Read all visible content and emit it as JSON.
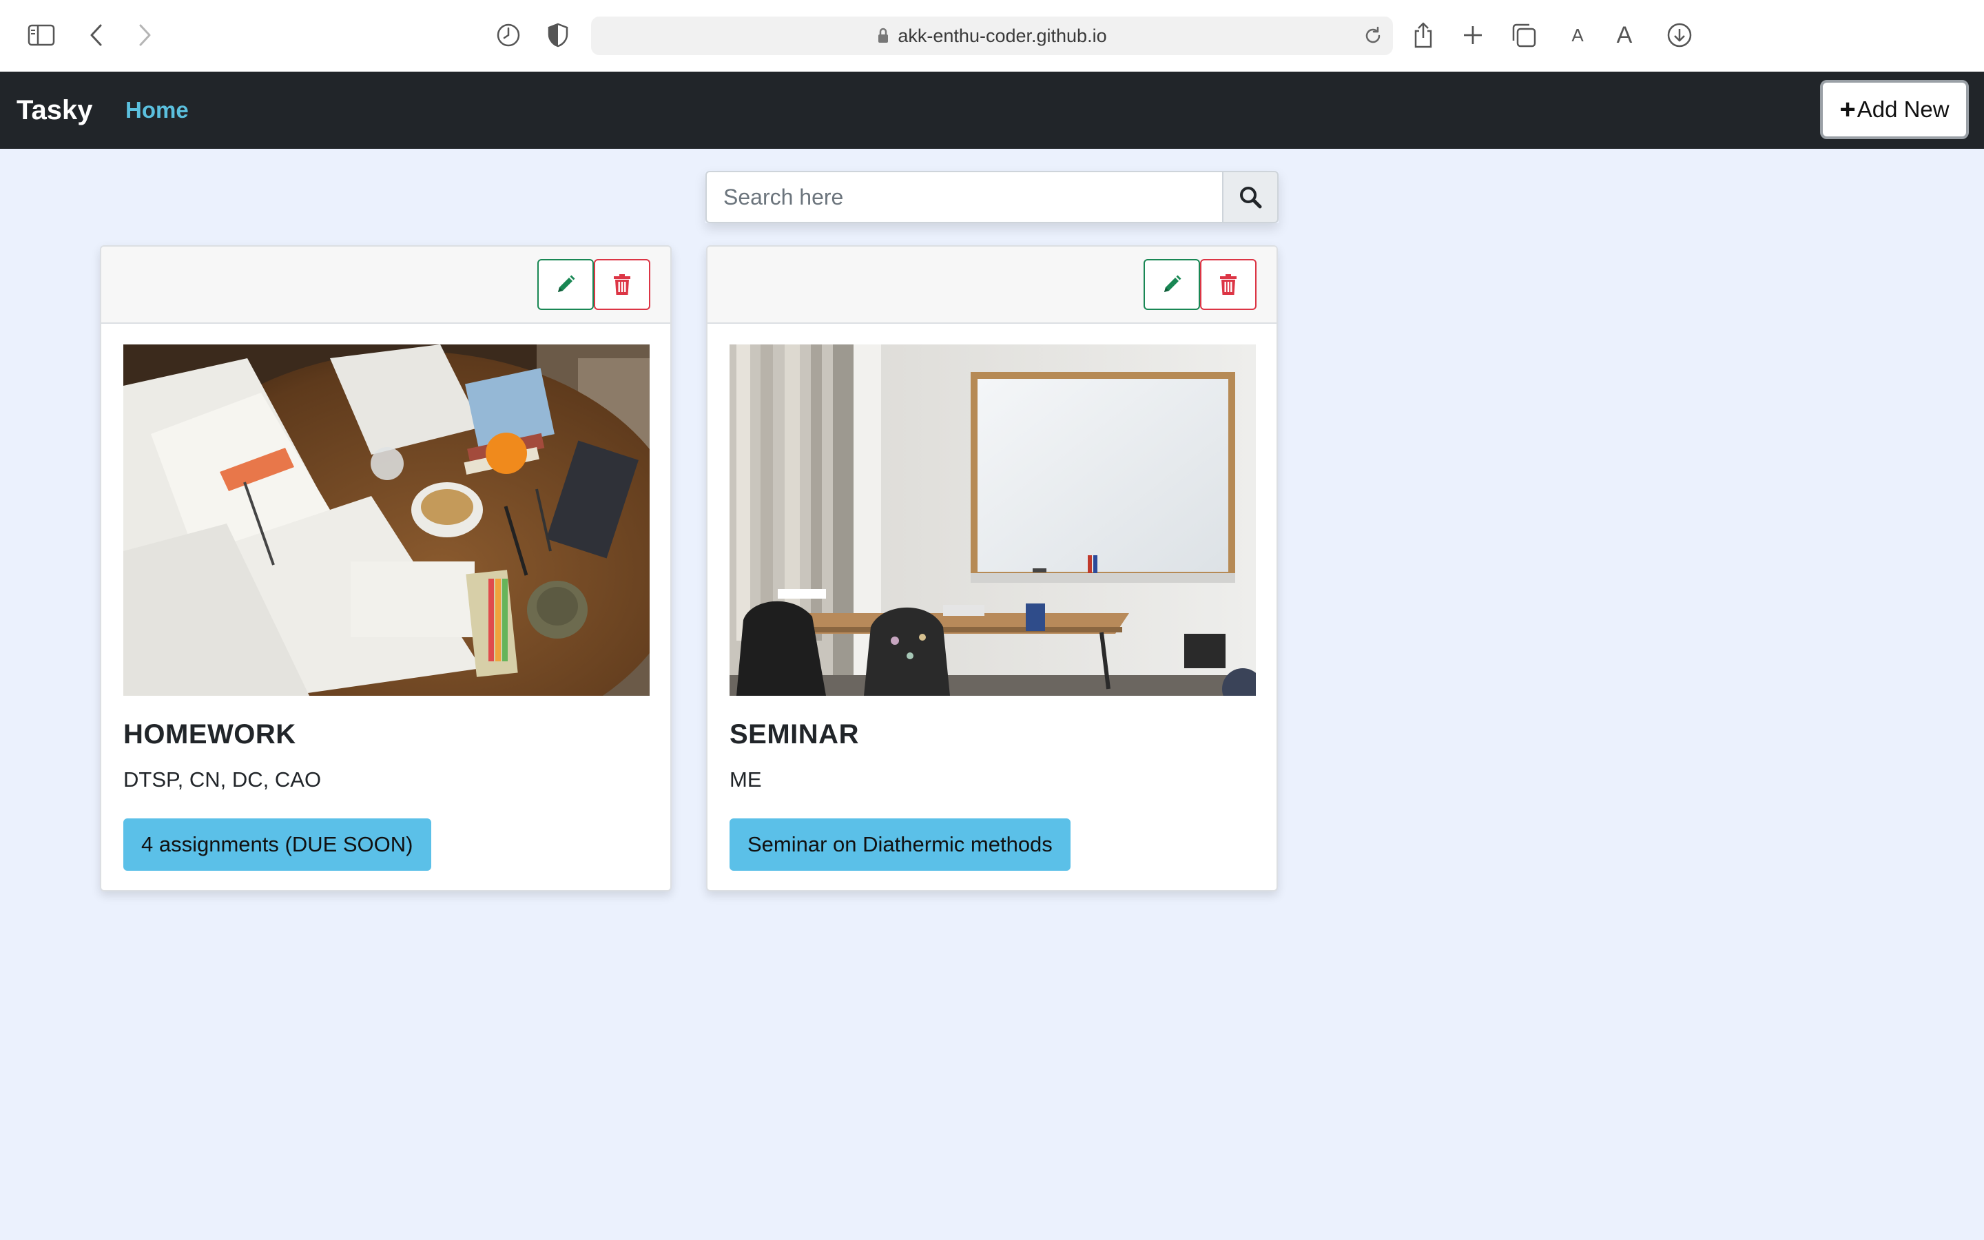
{
  "browser": {
    "url": "akk-enthu-coder.github.io",
    "font_small": "A",
    "font_large": "A"
  },
  "navbar": {
    "brand": "Tasky",
    "home_label": "Home",
    "add_new_plus": "+",
    "add_new_label": "Add New"
  },
  "search": {
    "placeholder": "Search here",
    "value": ""
  },
  "cards": [
    {
      "title": "HOMEWORK",
      "description": "DTSP, CN, DC, CAO",
      "badge": "4 assignments (DUE SOON)"
    },
    {
      "title": "SEMINAR",
      "description": "ME",
      "badge": "Seminar on Diathermic methods"
    }
  ],
  "colors": {
    "page_bg": "#ebf1fd",
    "navbar_bg": "#212529",
    "nav_link": "#5bc0de",
    "badge_bg": "#5bc0e8",
    "edit_green": "#198754",
    "delete_red": "#dc3545"
  },
  "icons": {
    "sidebar": "sidebar-icon",
    "back": "chevron-left-icon",
    "forward": "chevron-right-icon",
    "history": "clock-icon",
    "privacy": "shield-icon",
    "lock": "lock-icon",
    "reload": "reload-icon",
    "share": "share-icon",
    "new_tab": "plus-icon",
    "tabs": "tabs-icon",
    "download": "download-icon",
    "search": "search-icon",
    "edit": "pencil-icon",
    "delete": "trash-icon"
  }
}
